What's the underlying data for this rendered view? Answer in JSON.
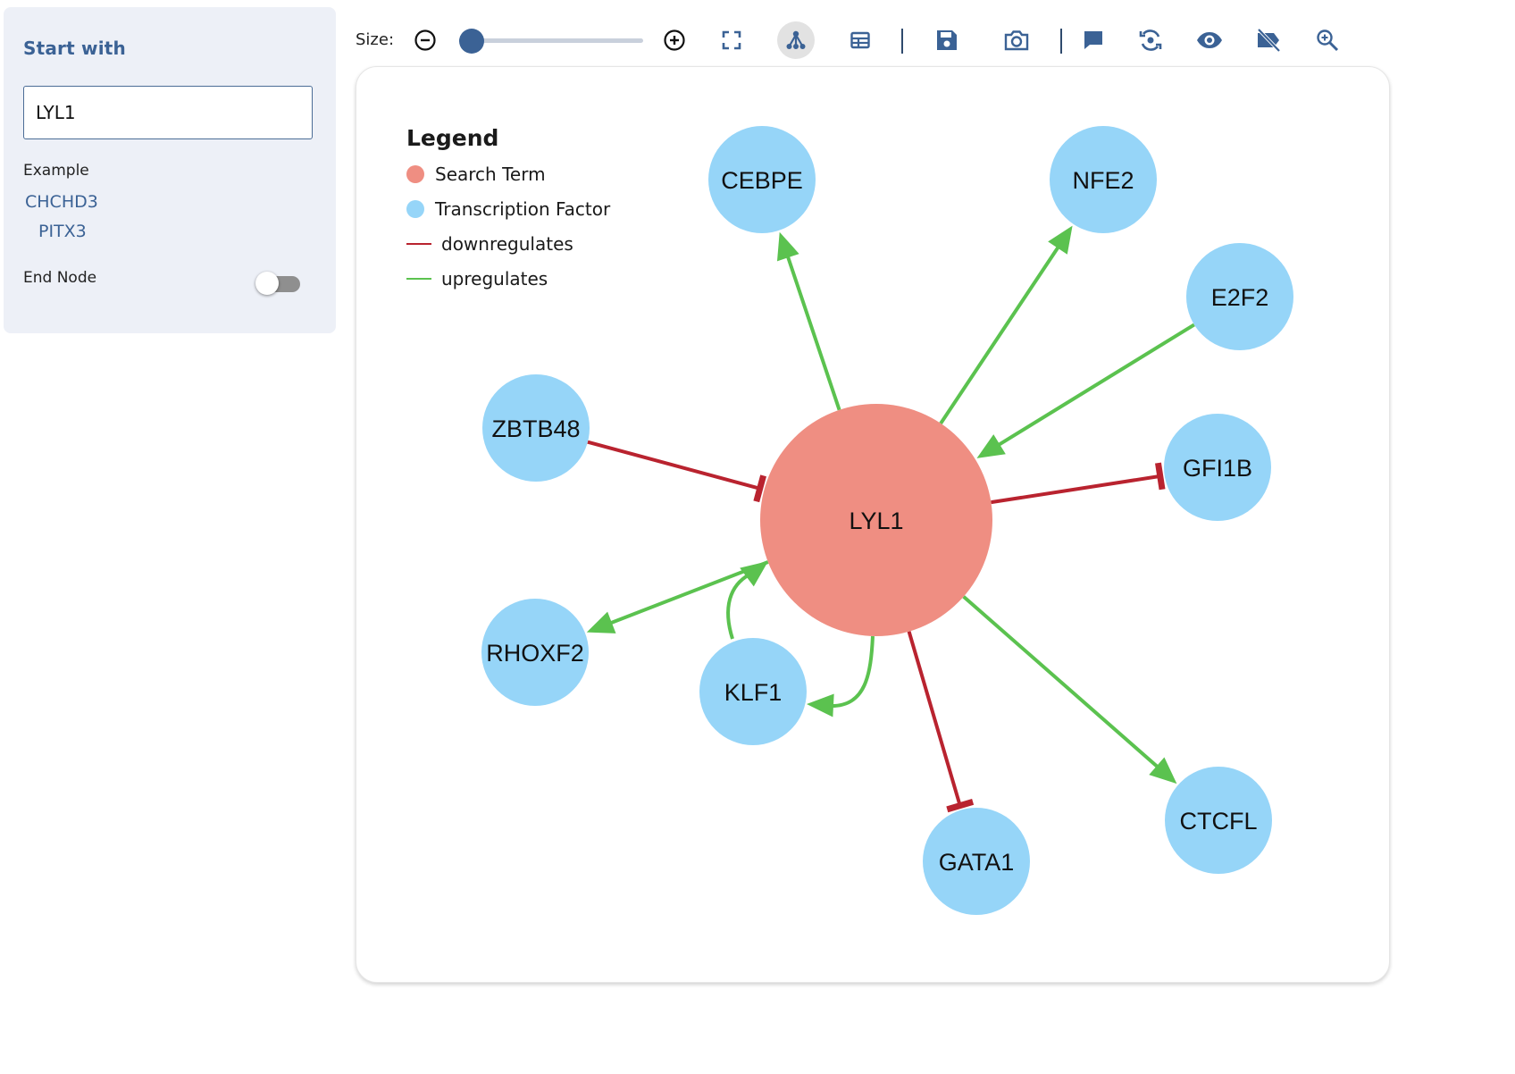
{
  "sidebar": {
    "title": "Start with",
    "search_value": "LYL1",
    "example_label": "Example",
    "examples": [
      "CHCHD3",
      "PITX3"
    ],
    "end_node_label": "End Node",
    "end_node_on": false
  },
  "toolbar": {
    "size_label": "Size:",
    "size_level": 0.07,
    "active_tool": "network-view",
    "buttons": [
      "zoom-out",
      "zoom-in",
      "fit-screen",
      "network-view",
      "table-view",
      "save",
      "screenshot",
      "comment",
      "reset-layout",
      "show",
      "hide-labels",
      "zoom-search"
    ]
  },
  "legend": {
    "title": "Legend",
    "items": [
      {
        "label": "Search Term",
        "kind": "dot",
        "color": "#ef8e82"
      },
      {
        "label": "Transcription Factor",
        "kind": "dot",
        "color": "#96d5f8"
      },
      {
        "label": "downregulates",
        "kind": "line",
        "color": "#b9232f"
      },
      {
        "label": "upregulates",
        "kind": "line",
        "color": "#5bc24f"
      }
    ]
  },
  "graph": {
    "colors": {
      "search": "#ef8e82",
      "factor": "#96d5f8",
      "down": "#b9232f",
      "up": "#5bc24f"
    },
    "center": "LYL1",
    "nodes": [
      "LYL1",
      "CEBPE",
      "NFE2",
      "E2F2",
      "GFI1B",
      "CTCFL",
      "GATA1",
      "KLF1",
      "RHOXF2",
      "ZBTB48"
    ],
    "edges": [
      {
        "source": "LYL1",
        "target": "CEBPE",
        "type": "upregulates"
      },
      {
        "source": "LYL1",
        "target": "NFE2",
        "type": "upregulates"
      },
      {
        "source": "E2F2",
        "target": "LYL1",
        "type": "upregulates"
      },
      {
        "source": "LYL1",
        "target": "GFI1B",
        "type": "downregulates"
      },
      {
        "source": "LYL1",
        "target": "CTCFL",
        "type": "upregulates"
      },
      {
        "source": "LYL1",
        "target": "GATA1",
        "type": "downregulates"
      },
      {
        "source": "LYL1",
        "target": "KLF1",
        "type": "upregulates"
      },
      {
        "source": "KLF1",
        "target": "LYL1",
        "type": "upregulates"
      },
      {
        "source": "LYL1",
        "target": "RHOXF2",
        "type": "upregulates"
      },
      {
        "source": "ZBTB48",
        "target": "LYL1",
        "type": "downregulates"
      }
    ]
  }
}
